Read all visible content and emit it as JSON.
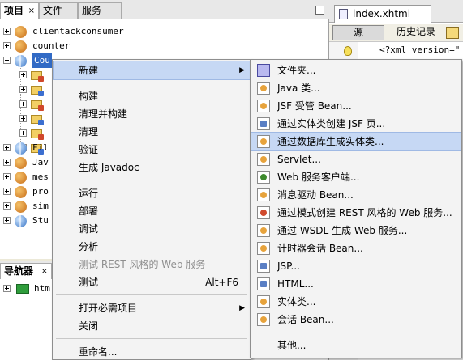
{
  "projects_panel": {
    "tabs": [
      {
        "label": "项目",
        "close": "×"
      },
      {
        "label": "文件",
        "close": ""
      },
      {
        "label": "服务",
        "close": ""
      }
    ],
    "tree": [
      {
        "label": "clientackconsumer",
        "icon": "coffee-cup-icon"
      },
      {
        "label": "counter",
        "icon": "coffee-cup-icon"
      },
      {
        "label": "Cou",
        "icon": "globe-icon",
        "selected": true
      },
      {
        "label": "",
        "icon": "folder-icon"
      },
      {
        "label": "",
        "icon": "folder-icon"
      },
      {
        "label": "",
        "icon": "folder-icon"
      },
      {
        "label": "",
        "icon": "folder-icon"
      },
      {
        "label": "",
        "icon": "folder-icon"
      },
      {
        "label": "",
        "icon": "folder-icon"
      },
      {
        "label": "Fil",
        "icon": "globe-icon"
      },
      {
        "label": "Jav",
        "icon": "coffee-cup-icon"
      },
      {
        "label": "mes",
        "icon": "coffee-cup-icon"
      },
      {
        "label": "pro",
        "icon": "coffee-cup-icon"
      },
      {
        "label": "sim",
        "icon": "coffee-cup-icon"
      },
      {
        "label": "Stu",
        "icon": "globe-icon"
      }
    ]
  },
  "navigator": {
    "tab_label": "导航器",
    "tab_close": "×",
    "item_label": "htm"
  },
  "editor": {
    "file_tab": "index.xhtml",
    "source_label": "源",
    "history_label": "历史记录",
    "code_line": "<?xml version=\""
  },
  "context_menu": {
    "items": [
      {
        "label": "新建",
        "submenu": true,
        "highlight": true
      },
      {
        "separator": true
      },
      {
        "label": "构建"
      },
      {
        "label": "清理并构建"
      },
      {
        "label": "清理"
      },
      {
        "label": "验证"
      },
      {
        "label": "生成 Javadoc"
      },
      {
        "separator": true
      },
      {
        "label": "运行"
      },
      {
        "label": "部署"
      },
      {
        "label": "调试"
      },
      {
        "label": "分析"
      },
      {
        "label": "测试 REST 风格的 Web 服务",
        "disabled": true
      },
      {
        "label": "测试",
        "accel": "Alt+F6"
      },
      {
        "separator": true
      },
      {
        "label": "打开必需项目",
        "submenu": true
      },
      {
        "label": "关闭"
      },
      {
        "separator": true
      },
      {
        "label": "重命名..."
      }
    ]
  },
  "submenu": {
    "items": [
      {
        "label": "文件夹...",
        "icon": "folder-icon"
      },
      {
        "label": "Java 类...",
        "icon": "java-class-icon"
      },
      {
        "label": "JSF 受管 Bean...",
        "icon": "bean-icon"
      },
      {
        "label": "通过实体类创建 JSF 页...",
        "icon": "page-icon"
      },
      {
        "label": "通过数据库生成实体类...",
        "icon": "entity-icon",
        "highlight": true
      },
      {
        "label": "Servlet...",
        "icon": "servlet-icon"
      },
      {
        "label": "Web 服务客户端...",
        "icon": "globe-icon"
      },
      {
        "label": "消息驱动 Bean...",
        "icon": "bean-icon"
      },
      {
        "label": "通过模式创建 REST 风格的 Web 服务...",
        "icon": "rest-icon"
      },
      {
        "label": "通过 WSDL 生成 Web 服务...",
        "icon": "wsdl-icon"
      },
      {
        "label": "计时器会话 Bean...",
        "icon": "bean-icon"
      },
      {
        "label": "JSP...",
        "icon": "jsp-icon"
      },
      {
        "label": "HTML...",
        "icon": "html-icon"
      },
      {
        "label": "实体类...",
        "icon": "entity-icon"
      },
      {
        "label": "会话 Bean...",
        "icon": "bean-icon"
      },
      {
        "separator": true
      },
      {
        "label": "其他..."
      }
    ]
  },
  "colors": {
    "selection": "#316ac5",
    "menu_highlight": "#c6d8f4",
    "menu_background": "#f3f3f3",
    "disabled_text": "#8f8f8f"
  }
}
